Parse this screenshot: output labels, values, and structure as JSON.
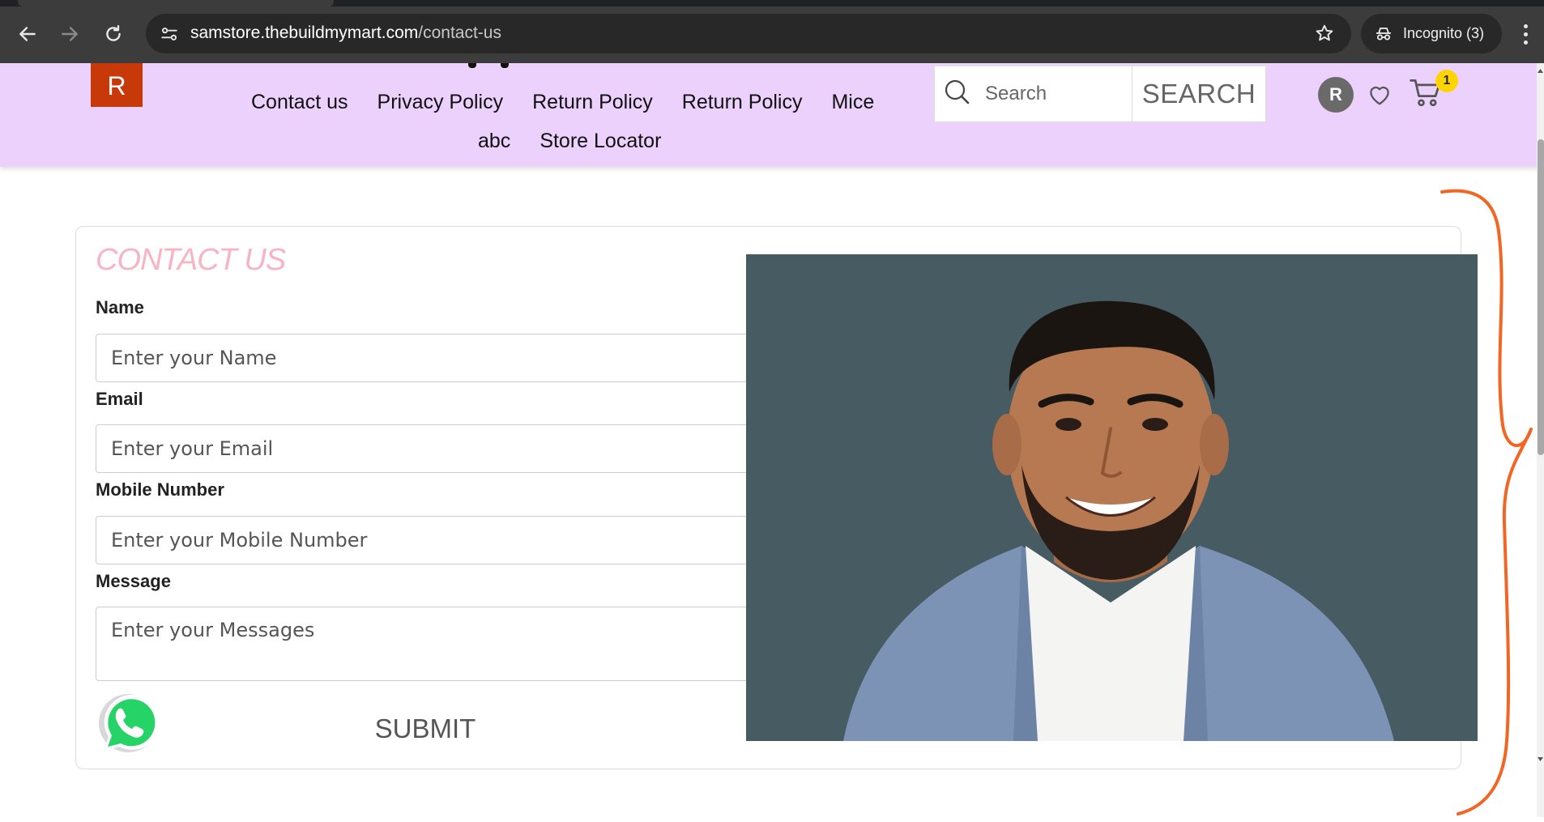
{
  "browser": {
    "url_host": "samstore.thebuildmymart.com",
    "url_path": "/contact-us",
    "incognito_label": "Incognito (3)",
    "icons": [
      "back-arrow-icon",
      "forward-arrow-icon",
      "reload-icon",
      "site-settings-icon",
      "bookmark-star-icon",
      "incognito-icon",
      "menu-dots-icon"
    ]
  },
  "header": {
    "logo_letter": "R",
    "nav_row1": [
      "Contact us",
      "Privacy Policy",
      "Return Policy",
      "Return Policy",
      "Mice"
    ],
    "nav_row2": [
      "abc",
      "Store Locator"
    ],
    "search_placeholder": "Search",
    "search_button": "SEARCH",
    "avatar_letter": "R",
    "cart_count": "1",
    "background_color": "#ecd1fd",
    "logo_color": "#c8390a"
  },
  "contact": {
    "title": "CONTACT US",
    "title_color": "#f7b4c4",
    "name_label": "Name",
    "name_placeholder": "Enter your Name",
    "email_label": "Email",
    "email_placeholder": "Enter your Email",
    "mobile_label": "Mobile Number",
    "mobile_placeholder": "Enter your Mobile Number",
    "message_label": "Message",
    "message_placeholder": "Enter your Messages",
    "submit_label": "SUBMIT"
  },
  "annotation_color": "#f26522"
}
